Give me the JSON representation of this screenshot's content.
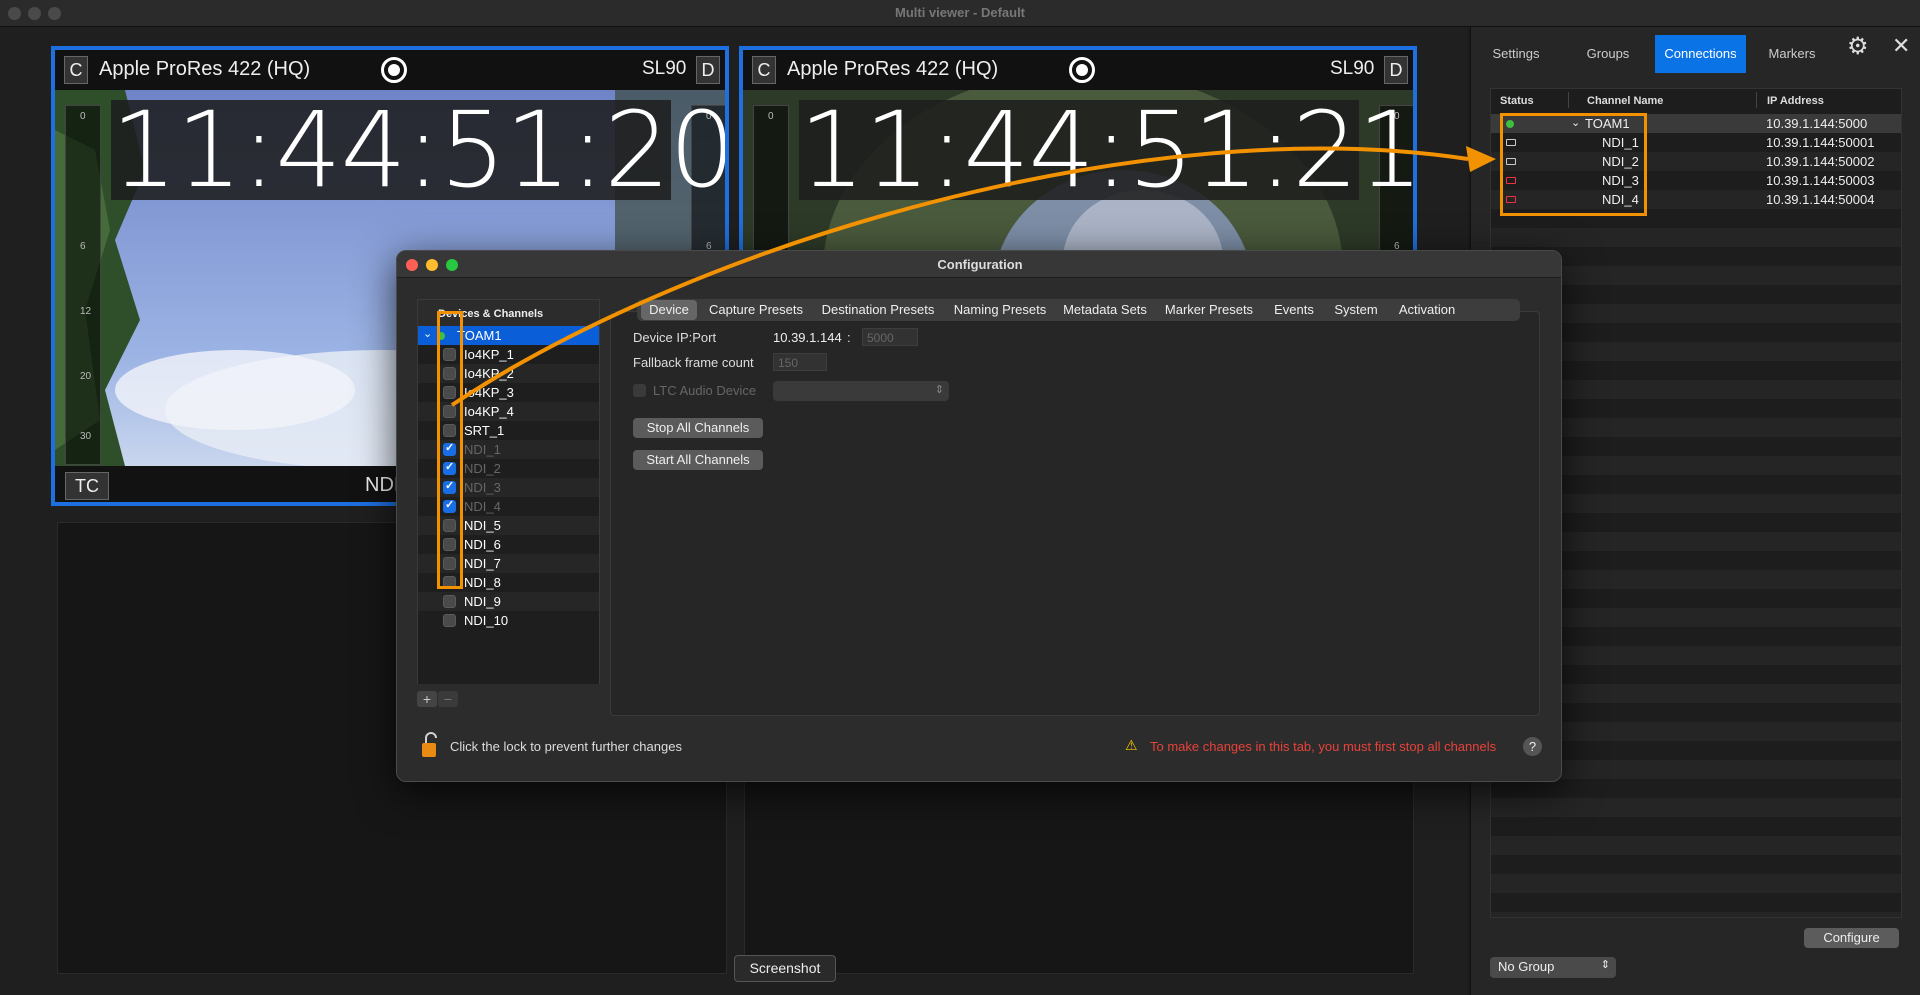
{
  "window": {
    "title": "Multi viewer - Default"
  },
  "tiles": [
    {
      "c_label": "C",
      "codec": "Apple ProRes 422 (HQ)",
      "sl": "SL90",
      "d_label": "D",
      "timecode": "11:44:51:20",
      "tc_chip": "TC",
      "source": "NDI"
    },
    {
      "c_label": "C",
      "codec": "Apple ProRes 422 (HQ)",
      "sl": "SL90",
      "d_label": "D",
      "timecode": "11:44:51:21"
    }
  ],
  "meter_marks": [
    "0",
    "6",
    "12",
    "20",
    "30"
  ],
  "screenshot_tooltip": "Screenshot",
  "right_panel": {
    "tabs": [
      "Settings",
      "Groups",
      "Connections",
      "Markers"
    ],
    "active_tab": "Connections",
    "columns": [
      "Status",
      "Channel Name",
      "IP Address"
    ],
    "rows": [
      {
        "status": "online",
        "name": "TOAM1",
        "ip": "10.39.1.144:5000"
      },
      {
        "status": "device",
        "name": "NDI_1",
        "ip": "10.39.1.144:50001"
      },
      {
        "status": "device",
        "name": "NDI_2",
        "ip": "10.39.1.144:50002"
      },
      {
        "status": "error",
        "name": "NDI_3",
        "ip": "10.39.1.144:50003"
      },
      {
        "status": "error",
        "name": "NDI_4",
        "ip": "10.39.1.144:50004"
      }
    ],
    "configure_label": "Configure",
    "group_select": "No Group"
  },
  "dialog": {
    "title": "Configuration",
    "devices_header": "Devices & Channels",
    "device_root": "TOAM1",
    "channels": [
      {
        "name": "Io4KP_1",
        "checked": false,
        "dim": false
      },
      {
        "name": "Io4KP_2",
        "checked": false,
        "dim": false
      },
      {
        "name": "Io4KP_3",
        "checked": false,
        "dim": false
      },
      {
        "name": "Io4KP_4",
        "checked": false,
        "dim": false
      },
      {
        "name": "SRT_1",
        "checked": false,
        "dim": false
      },
      {
        "name": "NDI_1",
        "checked": true,
        "dim": true
      },
      {
        "name": "NDI_2",
        "checked": true,
        "dim": true
      },
      {
        "name": "NDI_3",
        "checked": true,
        "dim": true
      },
      {
        "name": "NDI_4",
        "checked": true,
        "dim": true
      },
      {
        "name": "NDI_5",
        "checked": false,
        "dim": false
      },
      {
        "name": "NDI_6",
        "checked": false,
        "dim": false
      },
      {
        "name": "NDI_7",
        "checked": false,
        "dim": false
      },
      {
        "name": "NDI_8",
        "checked": false,
        "dim": false
      },
      {
        "name": "NDI_9",
        "checked": false,
        "dim": false
      },
      {
        "name": "NDI_10",
        "checked": false,
        "dim": false
      }
    ],
    "add_label": "+",
    "remove_label": "−",
    "tabs": [
      "Device",
      "Capture Presets",
      "Destination Presets",
      "Naming Presets",
      "Metadata Sets",
      "Marker Presets",
      "Events",
      "System",
      "Activation"
    ],
    "active_tab": "Device",
    "ip_label": "Device IP:Port",
    "ip_value": "10.39.1.144",
    "ip_sep": ":",
    "port_placeholder": "5000",
    "fallback_label": "Fallback frame count",
    "fallback_placeholder": "150",
    "ltc_label": "LTC Audio Device",
    "stop_all": "Stop All Channels",
    "start_all": "Start All Channels",
    "lock_text": "Click the lock to prevent further changes",
    "warning": "To make changes in this tab, you must first stop all channels",
    "help": "?"
  },
  "colors": {
    "accent": "#0a73e6",
    "tile_border": "#1e6fe0",
    "highlight": "#f39200",
    "warning": "#e8423a",
    "online": "#3fbf3f"
  }
}
